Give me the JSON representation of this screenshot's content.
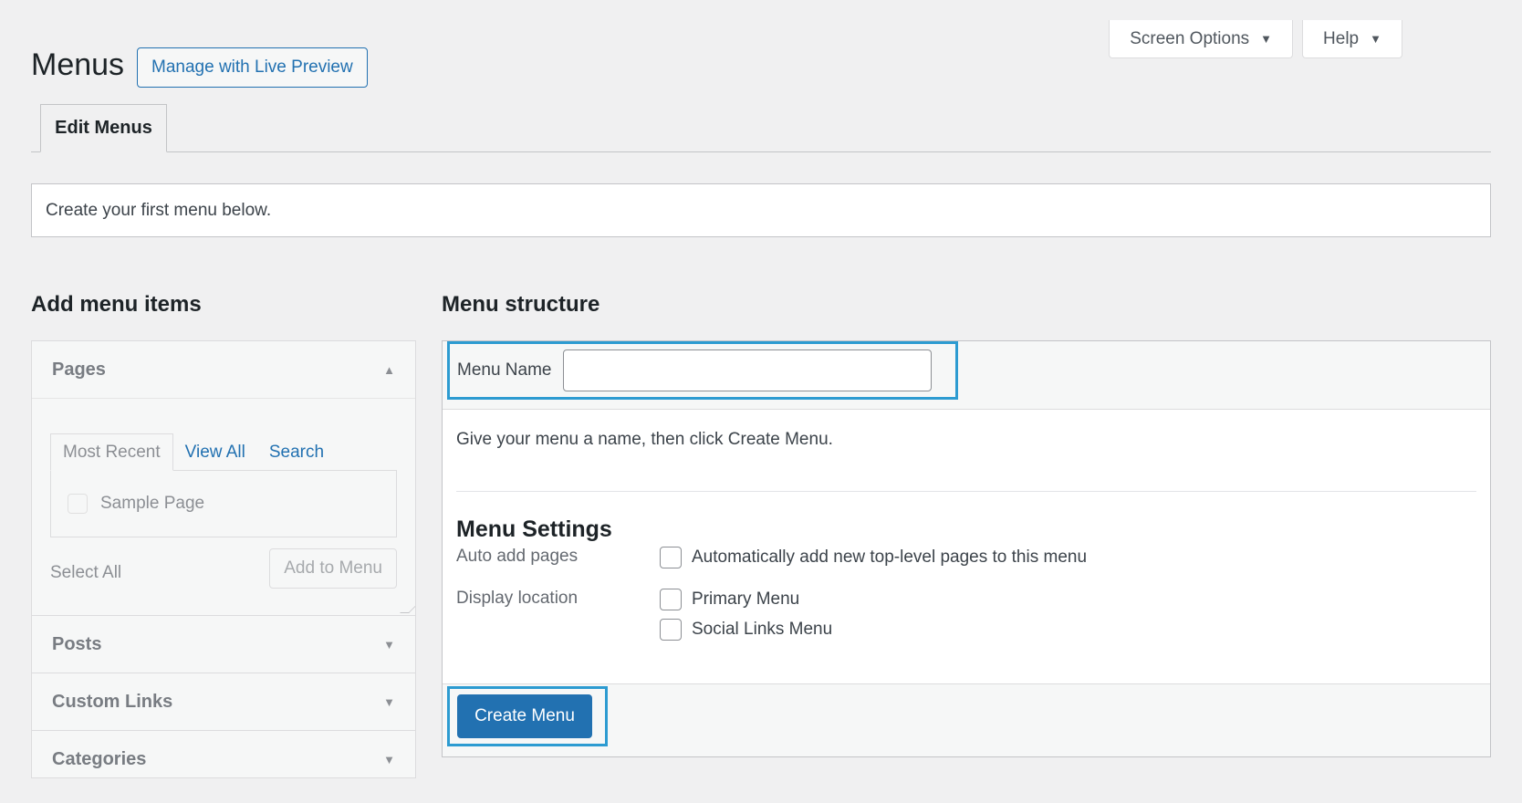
{
  "header": {
    "title": "Menus",
    "live_preview_label": "Manage with Live Preview",
    "screen_options_label": "Screen Options",
    "help_label": "Help"
  },
  "tabs": {
    "edit_menus": "Edit Menus"
  },
  "notice": {
    "text": "Create your first menu below."
  },
  "add_items": {
    "heading": "Add menu items",
    "sections": [
      {
        "label": "Pages"
      },
      {
        "label": "Posts"
      },
      {
        "label": "Custom Links"
      },
      {
        "label": "Categories"
      }
    ],
    "pages_tabs": [
      "Most Recent",
      "View All",
      "Search"
    ],
    "page_items": [
      "Sample Page"
    ],
    "select_all_label": "Select All",
    "add_to_menu_label": "Add to Menu"
  },
  "structure": {
    "heading": "Menu structure",
    "menu_name_label": "Menu Name",
    "menu_name_value": "",
    "instructions": "Give your menu a name, then click Create Menu.",
    "settings_title": "Menu Settings",
    "auto_add_label": "Auto add pages",
    "auto_add_option": "Automatically add new top-level pages to this menu",
    "display_location_label": "Display location",
    "locations": [
      "Primary Menu",
      "Social Links Menu"
    ],
    "create_button_label": "Create Menu"
  },
  "colors": {
    "accent": "#2271b1",
    "highlight": "#2d9bd1",
    "background": "#f0f0f1"
  }
}
